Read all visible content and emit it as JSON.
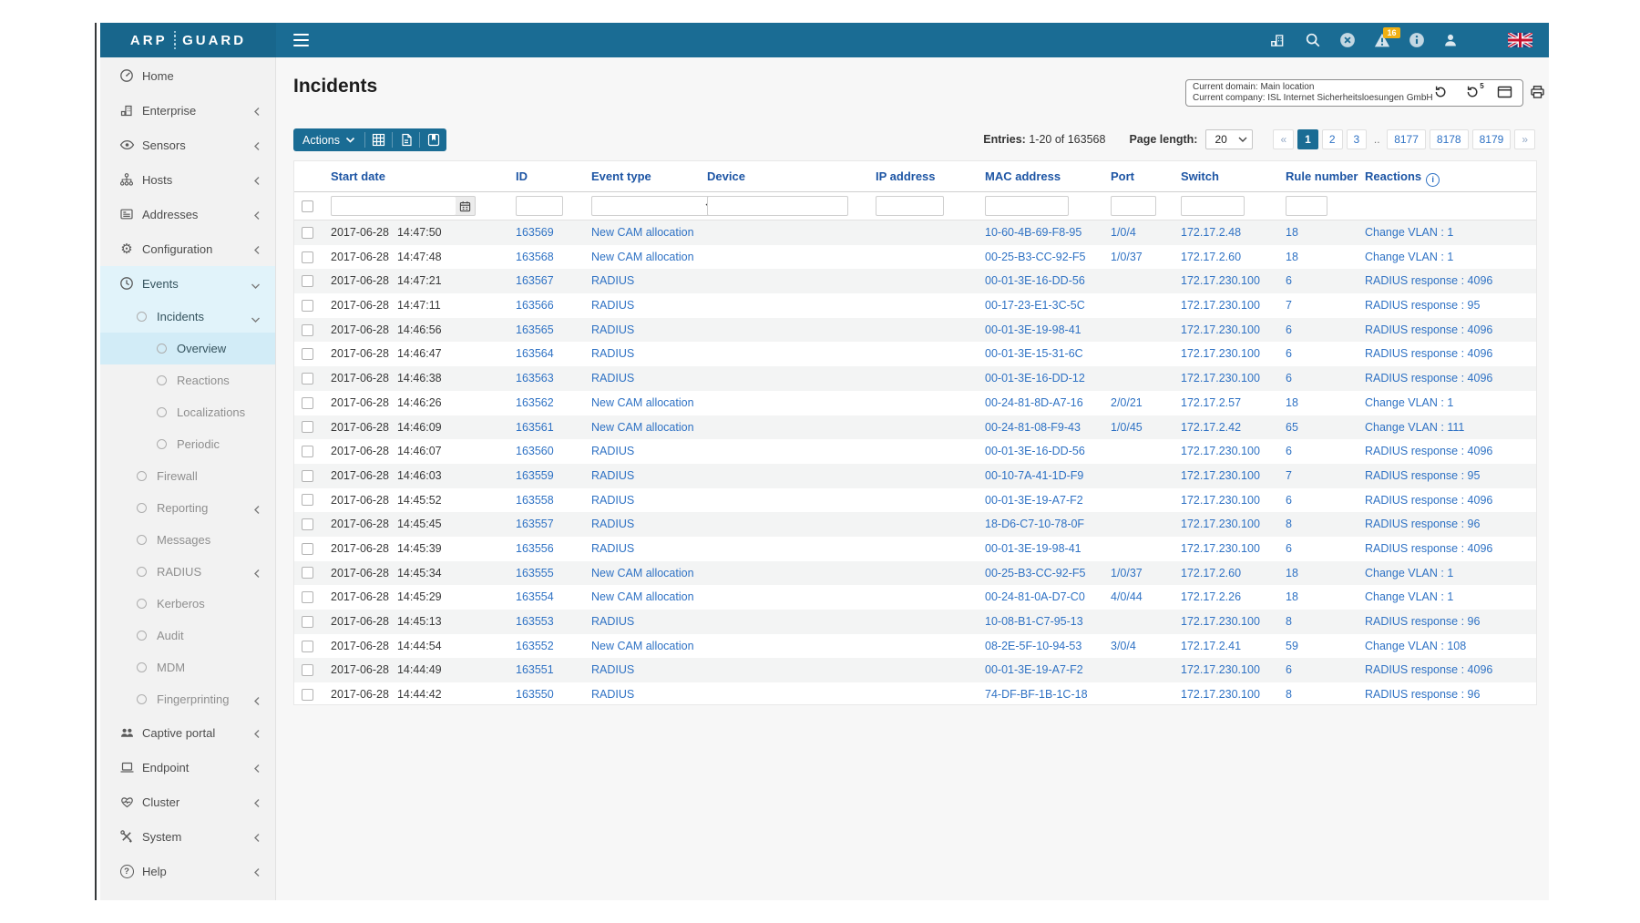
{
  "brand": {
    "arp": "ARP",
    "guard": "GUARD"
  },
  "colors": {
    "accent": "#1a6c94",
    "link": "#2f72c4",
    "header_blue": "#1d55a4",
    "badge": "#f0b014",
    "sidebar_active_bg": "#e1f3fa",
    "sidebar_selected_bg": "#d2ecf7",
    "stripe": "#f3f4f4"
  },
  "topbar": {
    "badge_count": "16",
    "icons": [
      {
        "name": "enterprise-chart-icon"
      },
      {
        "name": "search-icon"
      },
      {
        "name": "close-circle-icon"
      },
      {
        "name": "warning-icon"
      },
      {
        "name": "info-icon"
      },
      {
        "name": "user-icon"
      },
      {
        "name": "uk-flag-icon"
      }
    ]
  },
  "domain_box": {
    "line1": "Current domain: Main location",
    "line2": "Current company: ISL Internet Sicherheitsloesungen GmbH",
    "icons": [
      "refresh-icon",
      "refresh-interval-5-icon",
      "window-icon",
      "print-icon"
    ]
  },
  "page": {
    "title": "Incidents"
  },
  "toolbar": {
    "actions_label": "Actions",
    "icons": [
      "table-grid-icon",
      "export-file-icon",
      "bookmark-icon"
    ]
  },
  "entries": {
    "label": "Entries:",
    "value": "1-20 of 163568"
  },
  "page_length": {
    "label": "Page length:",
    "value": "20"
  },
  "pagination": {
    "items": [
      "«",
      "1",
      "2",
      "3",
      "..",
      "8177",
      "8178",
      "8179",
      "»"
    ],
    "active": "1"
  },
  "sidebar": {
    "items": [
      {
        "label": "Home",
        "icon": "gauge",
        "level": 1,
        "chevron": "",
        "state": ""
      },
      {
        "label": "Enterprise",
        "icon": "enterprise",
        "level": 1,
        "chevron": "left",
        "state": ""
      },
      {
        "label": "Sensors",
        "icon": "eye",
        "level": 1,
        "chevron": "left",
        "state": ""
      },
      {
        "label": "Hosts",
        "icon": "network",
        "level": 1,
        "chevron": "left",
        "state": ""
      },
      {
        "label": "Addresses",
        "icon": "list",
        "level": 1,
        "chevron": "left",
        "state": ""
      },
      {
        "label": "Configuration",
        "icon": "gear",
        "level": 1,
        "chevron": "left",
        "state": ""
      },
      {
        "label": "Events",
        "icon": "clock",
        "level": 1,
        "chevron": "down",
        "state": "active"
      },
      {
        "label": "Incidents",
        "icon": "circle",
        "level": 2,
        "chevron": "down",
        "state": "active"
      },
      {
        "label": "Overview",
        "icon": "circle",
        "level": 3,
        "chevron": "",
        "state": "selected"
      },
      {
        "label": "Reactions",
        "icon": "circle",
        "level": 3,
        "chevron": "",
        "state": "muted"
      },
      {
        "label": "Localizations",
        "icon": "circle",
        "level": 3,
        "chevron": "",
        "state": "muted"
      },
      {
        "label": "Periodic",
        "icon": "circle",
        "level": 3,
        "chevron": "",
        "state": "muted"
      },
      {
        "label": "Firewall",
        "icon": "circle",
        "level": 2,
        "chevron": "",
        "state": "muted"
      },
      {
        "label": "Reporting",
        "icon": "circle",
        "level": 2,
        "chevron": "left",
        "state": "muted"
      },
      {
        "label": "Messages",
        "icon": "circle",
        "level": 2,
        "chevron": "",
        "state": "muted"
      },
      {
        "label": "RADIUS",
        "icon": "circle",
        "level": 2,
        "chevron": "left",
        "state": "muted"
      },
      {
        "label": "Kerberos",
        "icon": "circle",
        "level": 2,
        "chevron": "",
        "state": "muted"
      },
      {
        "label": "Audit",
        "icon": "circle",
        "level": 2,
        "chevron": "",
        "state": "muted"
      },
      {
        "label": "MDM",
        "icon": "circle",
        "level": 2,
        "chevron": "",
        "state": "muted"
      },
      {
        "label": "Fingerprinting",
        "icon": "circle",
        "level": 2,
        "chevron": "left",
        "state": "muted"
      },
      {
        "label": "Captive portal",
        "icon": "people",
        "level": 1,
        "chevron": "left",
        "state": ""
      },
      {
        "label": "Endpoint",
        "icon": "laptop",
        "level": 1,
        "chevron": "left",
        "state": ""
      },
      {
        "label": "Cluster",
        "icon": "heart",
        "level": 1,
        "chevron": "left",
        "state": ""
      },
      {
        "label": "System",
        "icon": "tools",
        "level": 1,
        "chevron": "left",
        "state": ""
      },
      {
        "label": "Help",
        "icon": "question",
        "level": 1,
        "chevron": "left",
        "state": ""
      }
    ]
  },
  "table": {
    "columns": {
      "start_date": "Start date",
      "id": "ID",
      "event_type": "Event type",
      "device": "Device",
      "ip": "IP address",
      "mac": "MAC address",
      "port": "Port",
      "switch": "Switch",
      "rule": "Rule number",
      "reactions": "Reactions"
    },
    "filter_values": {
      "start_date": "",
      "id": "",
      "event_type": "",
      "device": "",
      "ip": "",
      "mac": "",
      "port": "",
      "switch": "",
      "rule": ""
    },
    "rows": [
      {
        "date": "2017-06-28",
        "time": "14:47:50",
        "id": "163569",
        "event": "New CAM allocation",
        "device": "",
        "ip": "",
        "mac": "10-60-4B-69-F8-95",
        "port": "1/0/4",
        "switch": "172.17.2.48",
        "rule": "18",
        "reaction": "Change VLAN : 1"
      },
      {
        "date": "2017-06-28",
        "time": "14:47:48",
        "id": "163568",
        "event": "New CAM allocation",
        "device": "",
        "ip": "",
        "mac": "00-25-B3-CC-92-F5",
        "port": "1/0/37",
        "switch": "172.17.2.60",
        "rule": "18",
        "reaction": "Change VLAN : 1"
      },
      {
        "date": "2017-06-28",
        "time": "14:47:21",
        "id": "163567",
        "event": "RADIUS",
        "device": "",
        "ip": "",
        "mac": "00-01-3E-16-DD-56",
        "port": "",
        "switch": "172.17.230.100",
        "rule": "6",
        "reaction": "RADIUS response : 4096"
      },
      {
        "date": "2017-06-28",
        "time": "14:47:11",
        "id": "163566",
        "event": "RADIUS",
        "device": "",
        "ip": "",
        "mac": "00-17-23-E1-3C-5C",
        "port": "",
        "switch": "172.17.230.100",
        "rule": "7",
        "reaction": "RADIUS response : 95"
      },
      {
        "date": "2017-06-28",
        "time": "14:46:56",
        "id": "163565",
        "event": "RADIUS",
        "device": "",
        "ip": "",
        "mac": "00-01-3E-19-98-41",
        "port": "",
        "switch": "172.17.230.100",
        "rule": "6",
        "reaction": "RADIUS response : 4096"
      },
      {
        "date": "2017-06-28",
        "time": "14:46:47",
        "id": "163564",
        "event": "RADIUS",
        "device": "",
        "ip": "",
        "mac": "00-01-3E-15-31-6C",
        "port": "",
        "switch": "172.17.230.100",
        "rule": "6",
        "reaction": "RADIUS response : 4096"
      },
      {
        "date": "2017-06-28",
        "time": "14:46:38",
        "id": "163563",
        "event": "RADIUS",
        "device": "",
        "ip": "",
        "mac": "00-01-3E-16-DD-12",
        "port": "",
        "switch": "172.17.230.100",
        "rule": "6",
        "reaction": "RADIUS response : 4096"
      },
      {
        "date": "2017-06-28",
        "time": "14:46:26",
        "id": "163562",
        "event": "New CAM allocation",
        "device": "",
        "ip": "",
        "mac": "00-24-81-8D-A7-16",
        "port": "2/0/21",
        "switch": "172.17.2.57",
        "rule": "18",
        "reaction": "Change VLAN : 1"
      },
      {
        "date": "2017-06-28",
        "time": "14:46:09",
        "id": "163561",
        "event": "New CAM allocation",
        "device": "",
        "ip": "",
        "mac": "00-24-81-08-F9-43",
        "port": "1/0/45",
        "switch": "172.17.2.42",
        "rule": "65",
        "reaction": "Change VLAN : 111"
      },
      {
        "date": "2017-06-28",
        "time": "14:46:07",
        "id": "163560",
        "event": "RADIUS",
        "device": "",
        "ip": "",
        "mac": "00-01-3E-16-DD-56",
        "port": "",
        "switch": "172.17.230.100",
        "rule": "6",
        "reaction": "RADIUS response : 4096"
      },
      {
        "date": "2017-06-28",
        "time": "14:46:03",
        "id": "163559",
        "event": "RADIUS",
        "device": "",
        "ip": "",
        "mac": "00-10-7A-41-1D-F9",
        "port": "",
        "switch": "172.17.230.100",
        "rule": "7",
        "reaction": "RADIUS response : 95"
      },
      {
        "date": "2017-06-28",
        "time": "14:45:52",
        "id": "163558",
        "event": "RADIUS",
        "device": "",
        "ip": "",
        "mac": "00-01-3E-19-A7-F2",
        "port": "",
        "switch": "172.17.230.100",
        "rule": "6",
        "reaction": "RADIUS response : 4096"
      },
      {
        "date": "2017-06-28",
        "time": "14:45:45",
        "id": "163557",
        "event": "RADIUS",
        "device": "",
        "ip": "",
        "mac": "18-D6-C7-10-78-0F",
        "port": "",
        "switch": "172.17.230.100",
        "rule": "8",
        "reaction": "RADIUS response : 96"
      },
      {
        "date": "2017-06-28",
        "time": "14:45:39",
        "id": "163556",
        "event": "RADIUS",
        "device": "",
        "ip": "",
        "mac": "00-01-3E-19-98-41",
        "port": "",
        "switch": "172.17.230.100",
        "rule": "6",
        "reaction": "RADIUS response : 4096"
      },
      {
        "date": "2017-06-28",
        "time": "14:45:34",
        "id": "163555",
        "event": "New CAM allocation",
        "device": "",
        "ip": "",
        "mac": "00-25-B3-CC-92-F5",
        "port": "1/0/37",
        "switch": "172.17.2.60",
        "rule": "18",
        "reaction": "Change VLAN : 1"
      },
      {
        "date": "2017-06-28",
        "time": "14:45:29",
        "id": "163554",
        "event": "New CAM allocation",
        "device": "",
        "ip": "",
        "mac": "00-24-81-0A-D7-C0",
        "port": "4/0/44",
        "switch": "172.17.2.26",
        "rule": "18",
        "reaction": "Change VLAN : 1"
      },
      {
        "date": "2017-06-28",
        "time": "14:45:13",
        "id": "163553",
        "event": "RADIUS",
        "device": "",
        "ip": "",
        "mac": "10-08-B1-C7-95-13",
        "port": "",
        "switch": "172.17.230.100",
        "rule": "8",
        "reaction": "RADIUS response : 96"
      },
      {
        "date": "2017-06-28",
        "time": "14:44:54",
        "id": "163552",
        "event": "New CAM allocation",
        "device": "",
        "ip": "",
        "mac": "08-2E-5F-10-94-53",
        "port": "3/0/4",
        "switch": "172.17.2.41",
        "rule": "59",
        "reaction": "Change VLAN : 108"
      },
      {
        "date": "2017-06-28",
        "time": "14:44:49",
        "id": "163551",
        "event": "RADIUS",
        "device": "",
        "ip": "",
        "mac": "00-01-3E-19-A7-F2",
        "port": "",
        "switch": "172.17.230.100",
        "rule": "6",
        "reaction": "RADIUS response : 4096"
      },
      {
        "date": "2017-06-28",
        "time": "14:44:42",
        "id": "163550",
        "event": "RADIUS",
        "device": "",
        "ip": "",
        "mac": "74-DF-BF-1B-1C-18",
        "port": "",
        "switch": "172.17.230.100",
        "rule": "8",
        "reaction": "RADIUS response : 96"
      }
    ]
  }
}
